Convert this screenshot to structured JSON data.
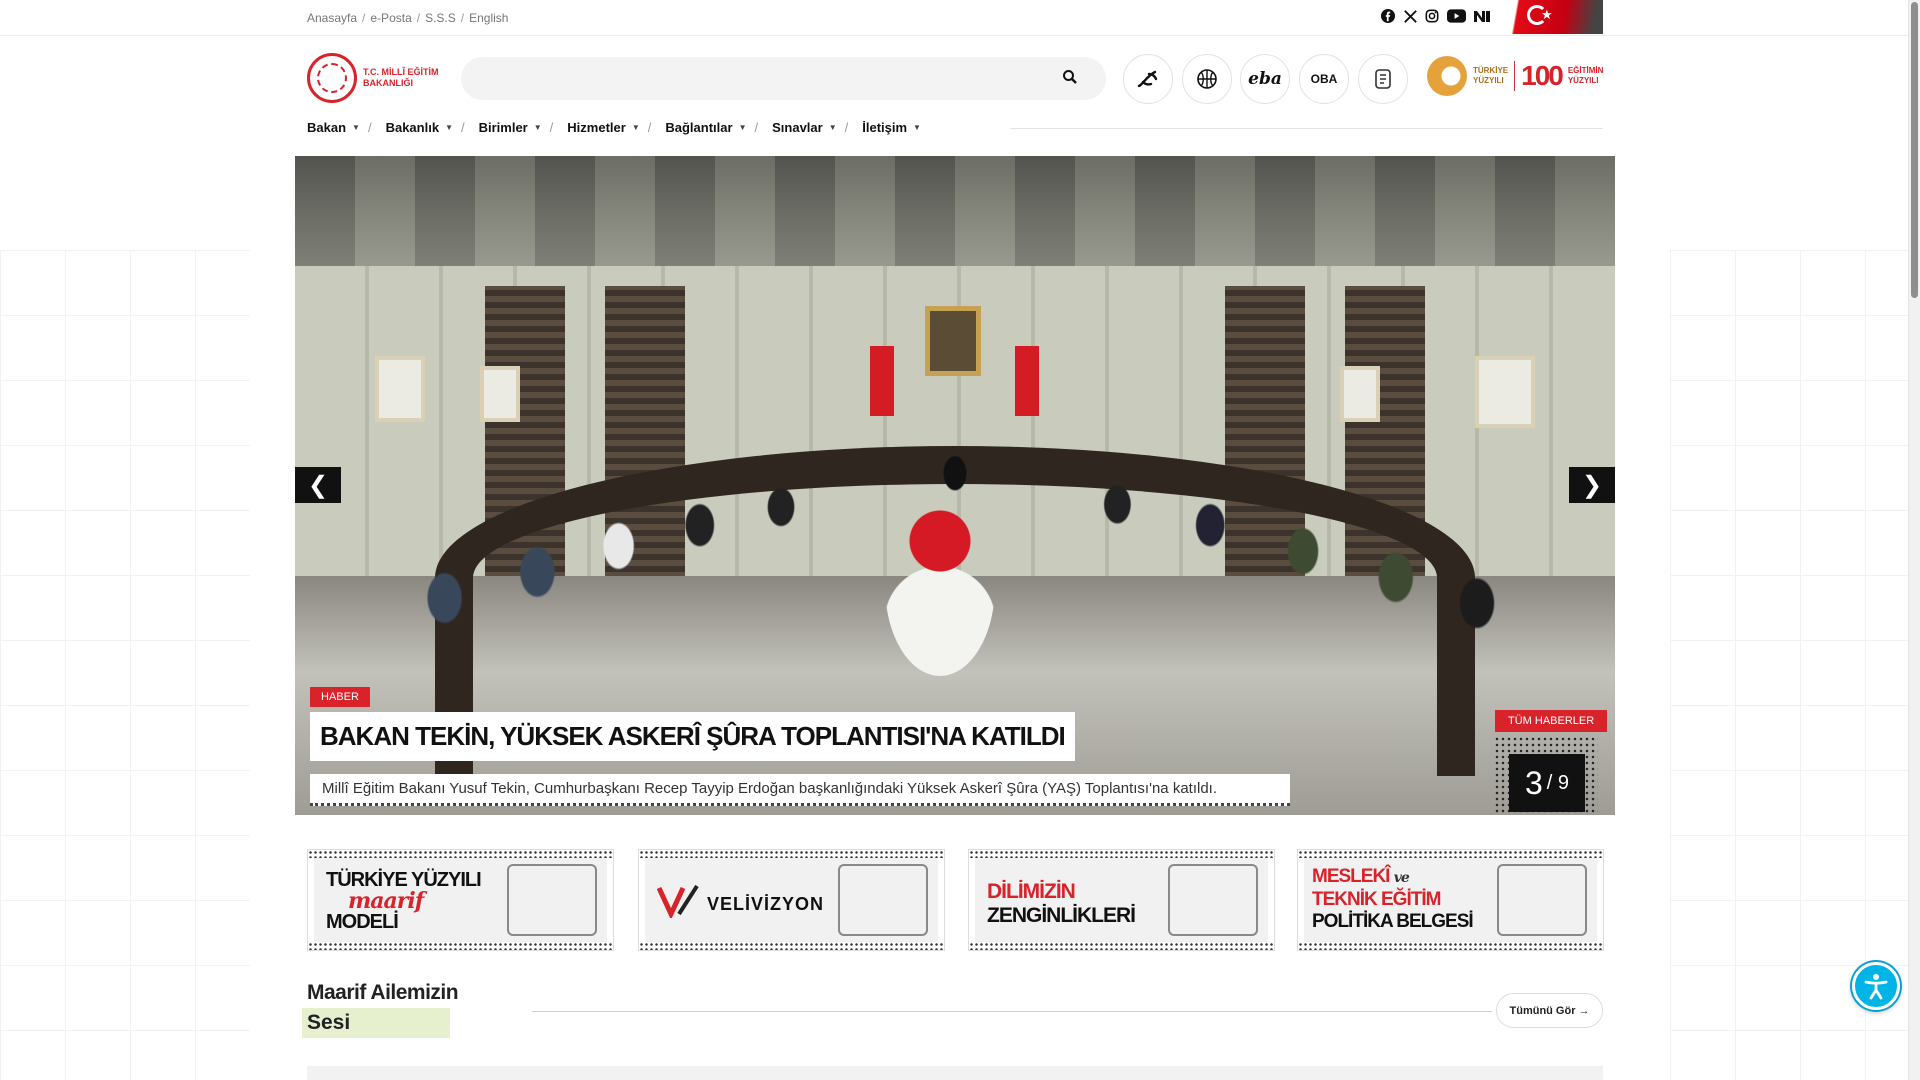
{
  "top_links": [
    "Anasayfa",
    "e-Posta",
    "S.S.S",
    "English"
  ],
  "social": [
    "facebook-icon",
    "x-icon",
    "instagram-icon",
    "youtube-icon",
    "nsosyal-icon"
  ],
  "logo": {
    "line1": "T.C. MİLLÎ EĞİTİM",
    "line2": "BAKANLIĞI"
  },
  "search": {
    "placeholder": ""
  },
  "quick_links": [
    "meb-icon",
    "basketball-icon",
    "eba",
    "OBA",
    "document-icon"
  ],
  "centennial": {
    "left1": "TÜRKİYE",
    "left2": "YÜZYILI",
    "number": "100",
    "right1": "EĞİTİMİN",
    "right2": "YÜZYILI"
  },
  "nav": [
    "Bakan",
    "Bakanlık",
    "Birimler",
    "Hizmetler",
    "Bağlantılar",
    "Sınavlar",
    "İletişim"
  ],
  "slider": {
    "tag": "HABER",
    "title": "BAKAN TEKİN, YÜKSEK ASKERÎ ŞÛRA TOPLANTISI'NA KATILDI",
    "description": "Millî Eğitim Bakanı Yusuf Tekin, Cumhurbaşkanı Recep Tayyip Erdoğan başkanlığındaki Yüksek Askerî Şûra (YAŞ) Toplantısı'na katıldı.",
    "all_news": "TÜM HABERLER",
    "current": "3",
    "total": "/ 9",
    "prev": "❮",
    "next": "❯"
  },
  "banners": {
    "b1": {
      "line1": "TÜRKİYE YÜZYILI",
      "cursive": "maarif",
      "line3": "MODELİ"
    },
    "b2": {
      "text": "VELİVİZYON"
    },
    "b3": {
      "line1": "DİLİMİZİN",
      "line2": "ZENGİNLİKLERİ"
    },
    "b4": {
      "line1": "MESLEKÎ",
      "cursive": "ve",
      "line2": "TEKNİK EĞİTİM",
      "line3": "POLİTİKA BELGESİ"
    }
  },
  "section": {
    "title1": "Maarif Ailemizin",
    "title2": "Sesi",
    "see_all": "Tümünü Gör"
  },
  "colors": {
    "brand_red": "#d8232a",
    "accessibility": "#00b4e6",
    "highlight": "#e6f0cf"
  }
}
